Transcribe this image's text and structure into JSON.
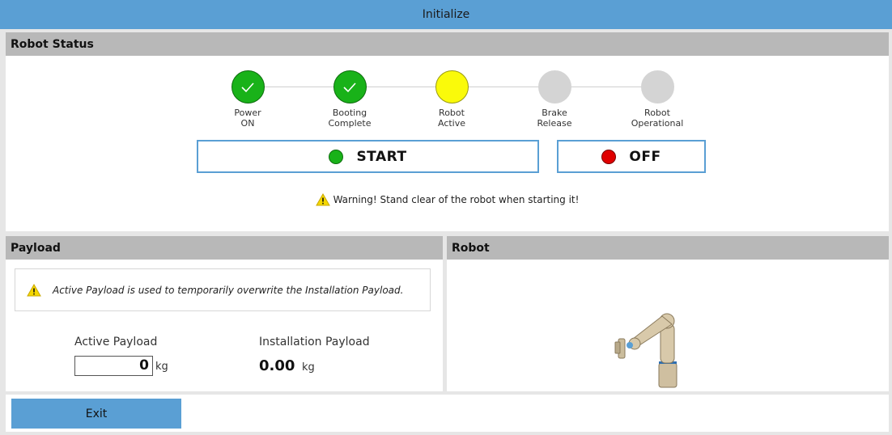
{
  "window": {
    "title": "Initialize"
  },
  "status": {
    "header": "Robot Status",
    "steps": [
      {
        "line1": "Power",
        "line2": "ON",
        "state": "done"
      },
      {
        "line1": "Booting",
        "line2": "Complete",
        "state": "done"
      },
      {
        "line1": "Robot",
        "line2": "Active",
        "state": "active"
      },
      {
        "line1": "Brake",
        "line2": "Release",
        "state": "pending"
      },
      {
        "line1": "Robot",
        "line2": "Operational",
        "state": "pending"
      }
    ],
    "start_label": "START",
    "off_label": "OFF",
    "warning": "Warning! Stand clear of the robot when starting it!"
  },
  "payload": {
    "header": "Payload",
    "notice": "Active Payload is used to temporarily overwrite the Installation Payload.",
    "active_label": "Active Payload",
    "active_value": "0",
    "active_unit": "kg",
    "installation_label": "Installation Payload",
    "installation_value": "0.00",
    "installation_unit": "kg"
  },
  "robot": {
    "header": "Robot"
  },
  "footer": {
    "exit_label": "Exit"
  },
  "colors": {
    "accent": "#5a9fd4",
    "done": "#19b219",
    "active": "#fafa0a",
    "pending": "#d4d4d4",
    "start_dot": "#19b219",
    "off_dot": "#e00000"
  }
}
